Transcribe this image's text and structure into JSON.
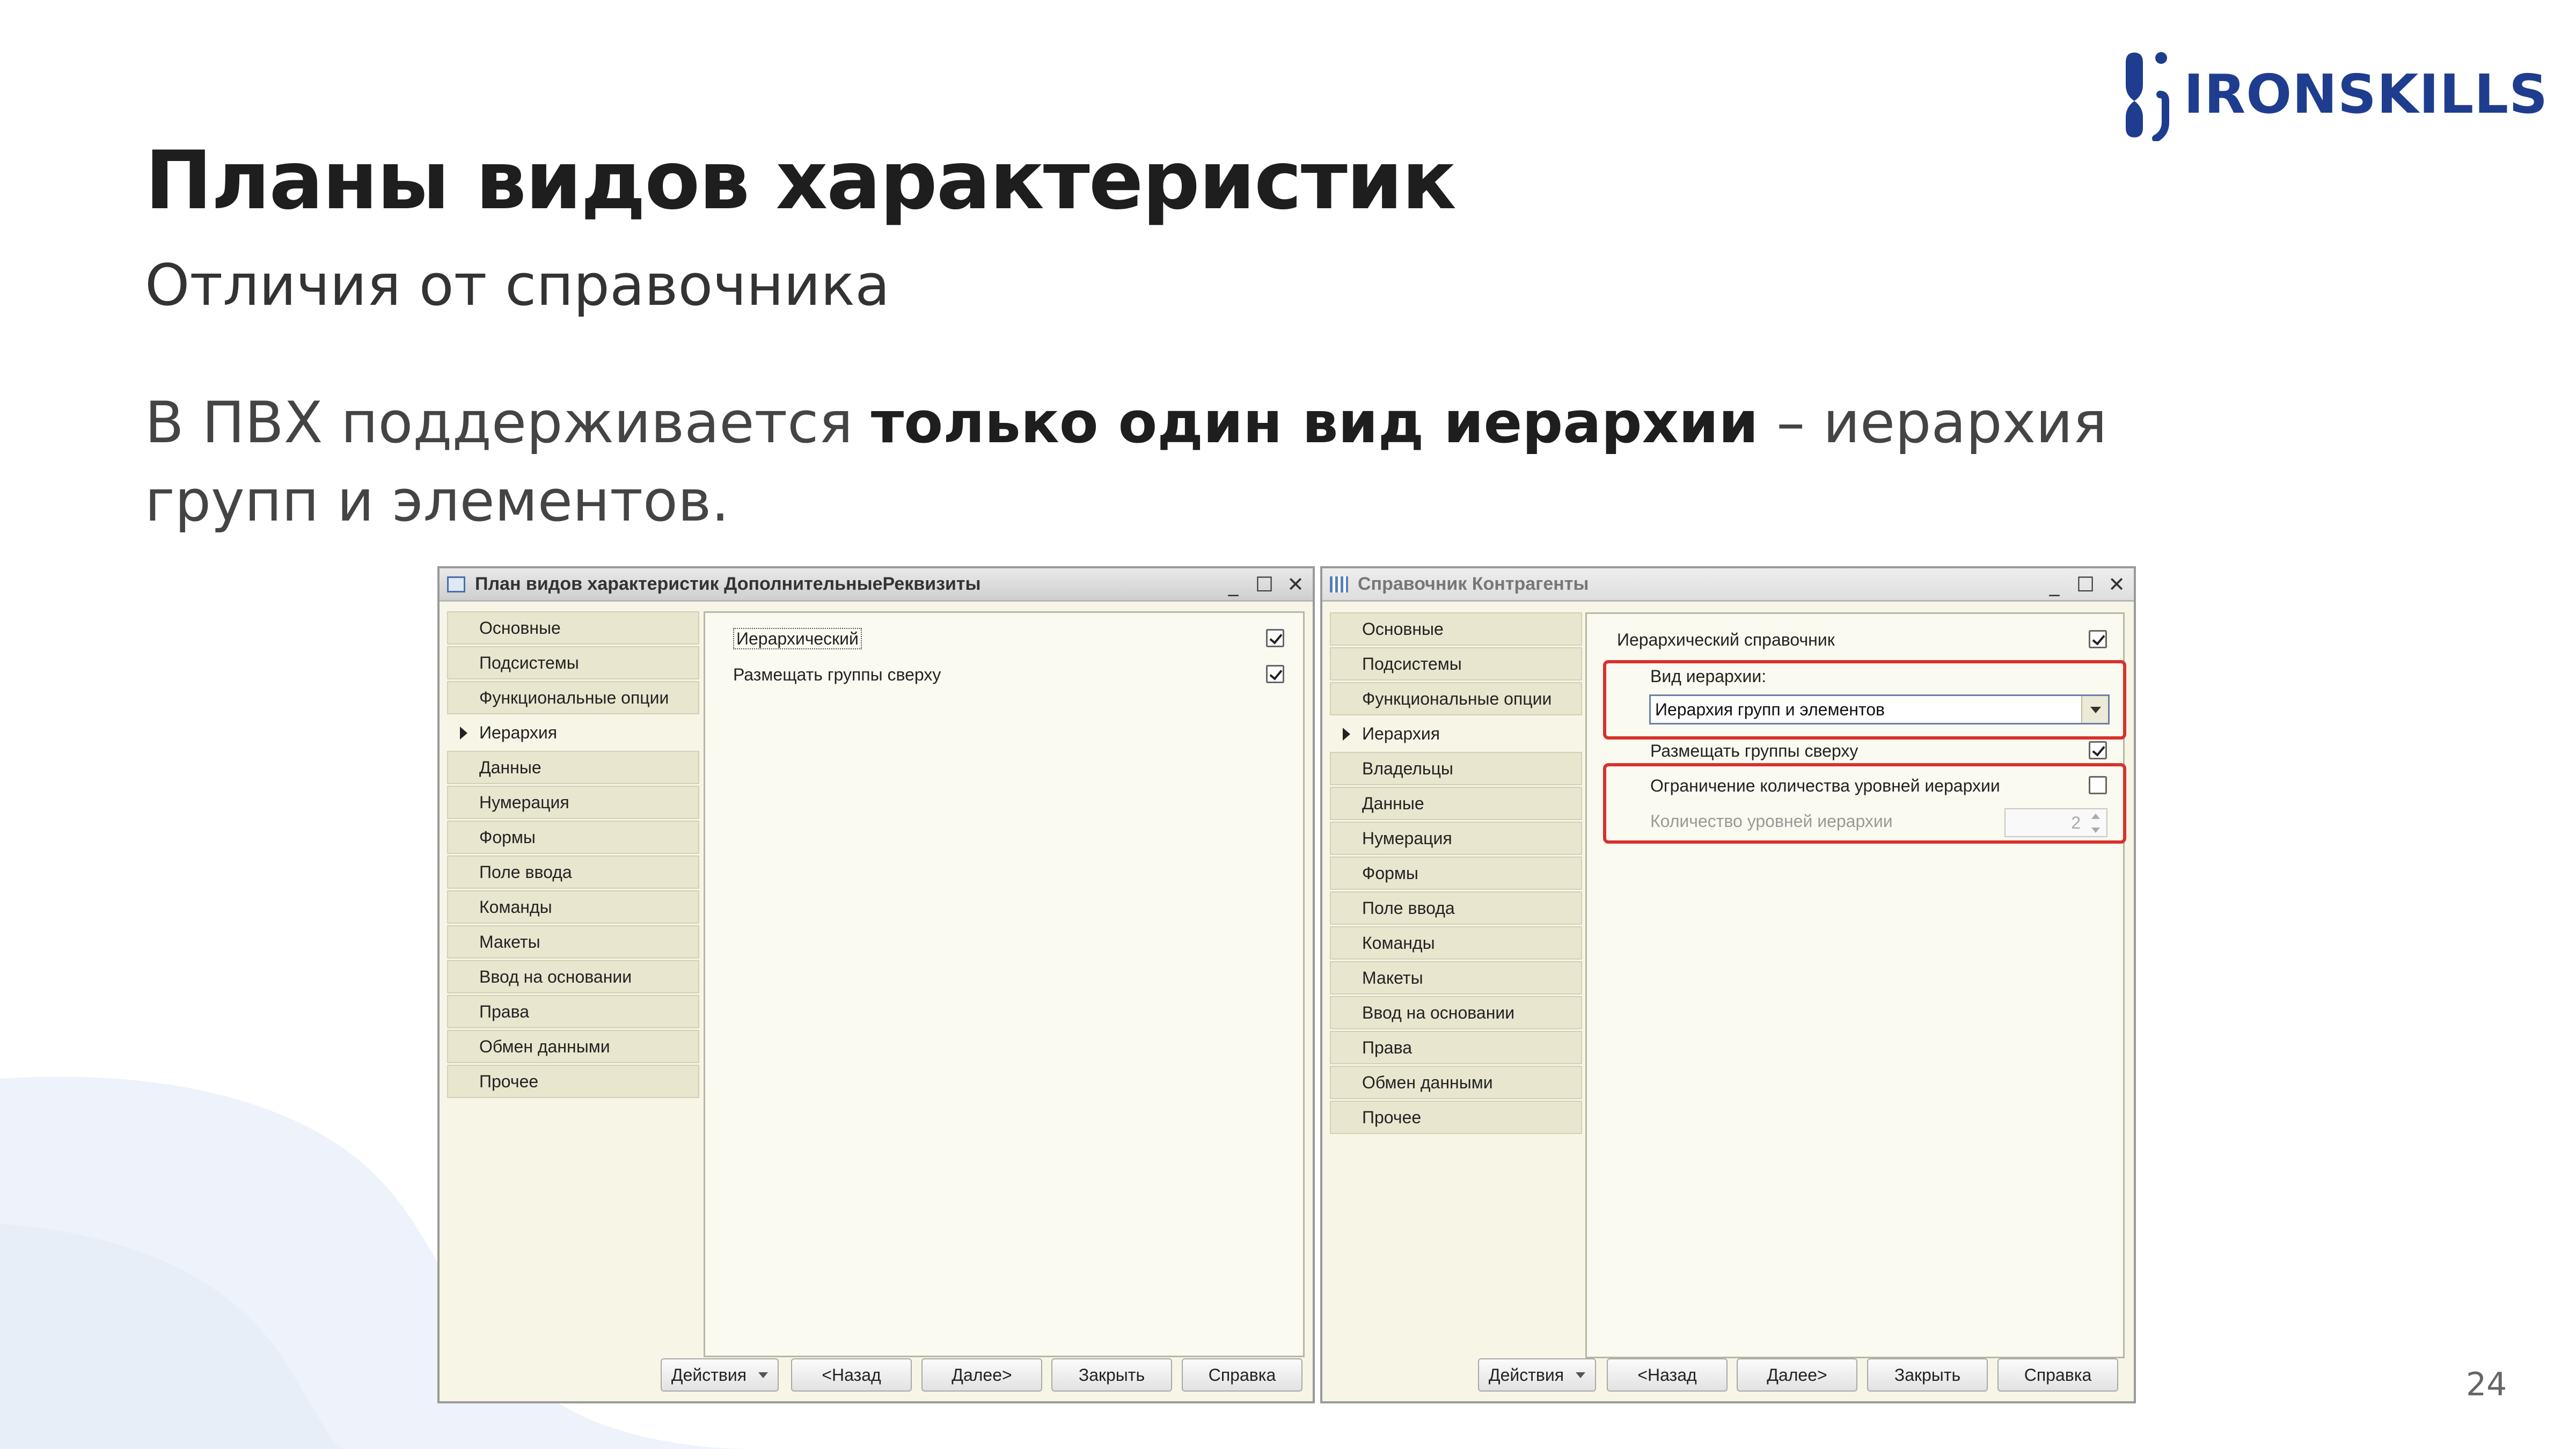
{
  "slide": {
    "title": "Планы видов характеристик",
    "subtitle": "Отличия от справочника",
    "body": {
      "part1": "В ПВХ поддерживается ",
      "bold": "только один вид иерархии",
      "part2": " – иерархия групп и элементов."
    },
    "page_number": "24",
    "logo_text": "IRONSKILLS",
    "highlight_color": "#d9302c"
  },
  "left_window": {
    "title": "План видов характеристик ДополнительныеРеквизиты",
    "nav_items": [
      "Основные",
      "Подсистемы",
      "Функциональные опции",
      "Иерархия",
      "Данные",
      "Нумерация",
      "Формы",
      "Поле ввода",
      "Команды",
      "Макеты",
      "Ввод на основании",
      "Права",
      "Обмен данными",
      "Прочее"
    ],
    "active_nav": "Иерархия",
    "options": [
      {
        "label": "Иерархический",
        "checked": true
      },
      {
        "label": "Размещать группы сверху",
        "checked": true
      }
    ],
    "buttons": {
      "actions": "Действия",
      "back": "<Назад",
      "next": "Далее>",
      "close": "Закрыть",
      "help": "Справка"
    }
  },
  "right_window": {
    "title": "Справочник Контрагенты",
    "nav_items": [
      "Основные",
      "Подсистемы",
      "Функциональные опции",
      "Иерархия",
      "Владельцы",
      "Данные",
      "Нумерация",
      "Формы",
      "Поле ввода",
      "Команды",
      "Макеты",
      "Ввод на основании",
      "Права",
      "Обмен данными",
      "Прочее"
    ],
    "active_nav": "Иерархия",
    "hierarchical_label": "Иерархический справочник",
    "hierarchical_checked": true,
    "hierarchy_kind_label": "Вид иерархии:",
    "hierarchy_kind_value": "Иерархия групп и элементов",
    "groups_on_top_label": "Размещать группы сверху",
    "groups_on_top_checked": true,
    "limit_levels_label": "Ограничение количества уровней иерархии",
    "limit_levels_checked": false,
    "levels_count_label": "Количество уровней иерархии",
    "levels_count_value": "2",
    "buttons": {
      "actions": "Действия",
      "back": "<Назад",
      "next": "Далее>",
      "close": "Закрыть",
      "help": "Справка"
    }
  }
}
